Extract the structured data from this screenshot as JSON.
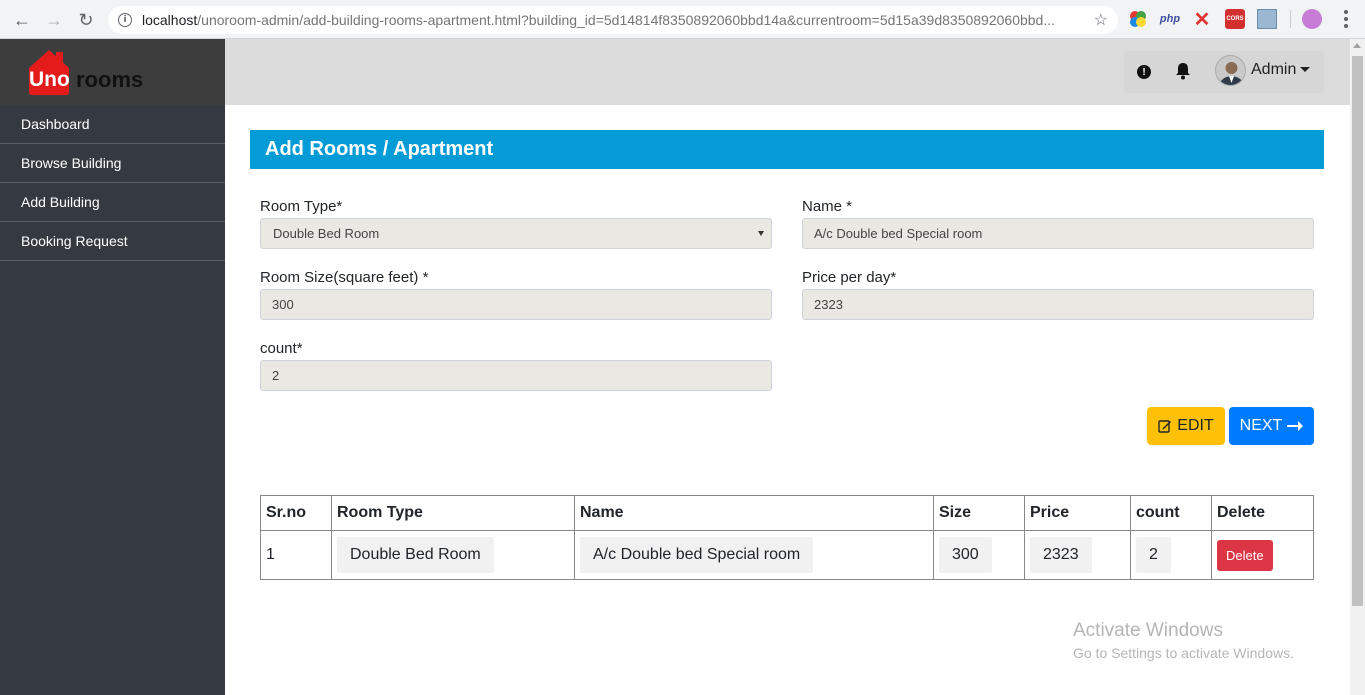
{
  "browser": {
    "url_host": "localhost",
    "url_rest": "/unoroom-admin/add-building-rooms-apartment.html?building_id=5d14814f8350892060bbd14a&currentroom=5d15a39d8350892060bbd..."
  },
  "brand": {
    "part1": "Uno",
    "part2": "rooms"
  },
  "sidebar": {
    "items": [
      {
        "label": "Dashboard"
      },
      {
        "label": "Browse Building"
      },
      {
        "label": "Add Building"
      },
      {
        "label": "Booking Request"
      }
    ]
  },
  "topbar": {
    "user_label": "Admin"
  },
  "page": {
    "title": "Add Rooms / Apartment"
  },
  "form": {
    "room_type": {
      "label": "Room Type*",
      "value": "Double Bed Room"
    },
    "name": {
      "label": "Name *",
      "value": "A/c Double bed Special room"
    },
    "room_size": {
      "label": "Room Size(square feet) *",
      "value": "300"
    },
    "price": {
      "label": "Price per day*",
      "value": "2323"
    },
    "count": {
      "label": "count*",
      "value": "2"
    },
    "edit_label": "EDIT",
    "next_label": "NEXT"
  },
  "table": {
    "headers": [
      "Sr.no",
      "Room Type",
      "Name",
      "Size",
      "Price",
      "count",
      "Delete"
    ],
    "rows": [
      {
        "srno": "1",
        "room_type": "Double Bed Room",
        "name": "A/c Double bed Special room",
        "size": "300",
        "price": "2323",
        "count": "2",
        "delete_label": "Delete"
      }
    ]
  },
  "watermark": {
    "line1": "Activate Windows",
    "line2": "Go to Settings to activate Windows."
  },
  "colors": {
    "header_blue": "#059bd6",
    "edit_yellow": "#ffc107",
    "next_blue": "#007bff",
    "delete_red": "#dc3545",
    "sidebar_dark": "#343a40",
    "logo_red": "#e41b1b"
  }
}
